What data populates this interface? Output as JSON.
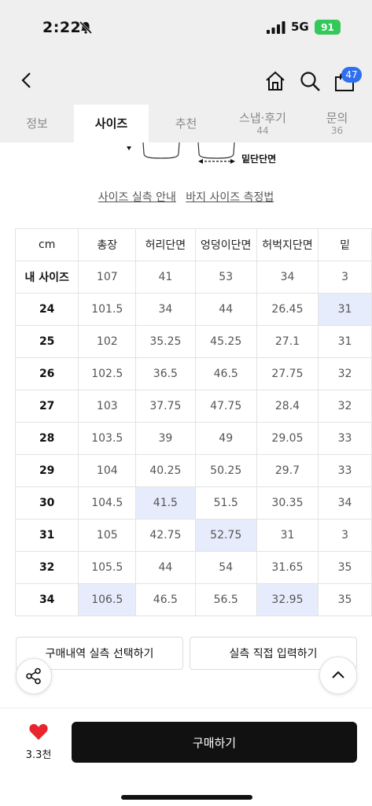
{
  "status": {
    "time": "2:22",
    "network": "5G",
    "battery": "91"
  },
  "nav": {
    "cart_count": "47"
  },
  "tabs": [
    {
      "label": "정보",
      "count": ""
    },
    {
      "label": "사이즈",
      "count": ""
    },
    {
      "label": "추천",
      "count": ""
    },
    {
      "label": "스냅·후기",
      "count": "44"
    },
    {
      "label": "문의",
      "count": "36"
    }
  ],
  "diagram": {
    "label": "밑단단면"
  },
  "links": {
    "guide": "사이즈 실측 안내",
    "measure": "바지 사이즈 측정법"
  },
  "size_table": {
    "headers": [
      "cm",
      "총장",
      "허리단면",
      "엉덩이단면",
      "허벅지단면",
      "밑"
    ],
    "rows": [
      {
        "label": "내 사이즈",
        "values": [
          "107",
          "41",
          "53",
          "34",
          "3"
        ],
        "highlight": []
      },
      {
        "label": "24",
        "values": [
          "101.5",
          "34",
          "44",
          "26.45",
          "31"
        ],
        "highlight": [
          4
        ]
      },
      {
        "label": "25",
        "values": [
          "102",
          "35.25",
          "45.25",
          "27.1",
          "31"
        ],
        "highlight": []
      },
      {
        "label": "26",
        "values": [
          "102.5",
          "36.5",
          "46.5",
          "27.75",
          "32"
        ],
        "highlight": []
      },
      {
        "label": "27",
        "values": [
          "103",
          "37.75",
          "47.75",
          "28.4",
          "32"
        ],
        "highlight": []
      },
      {
        "label": "28",
        "values": [
          "103.5",
          "39",
          "49",
          "29.05",
          "33"
        ],
        "highlight": []
      },
      {
        "label": "29",
        "values": [
          "104",
          "40.25",
          "50.25",
          "29.7",
          "33"
        ],
        "highlight": []
      },
      {
        "label": "30",
        "values": [
          "104.5",
          "41.5",
          "51.5",
          "30.35",
          "34"
        ],
        "highlight": [
          1
        ]
      },
      {
        "label": "31",
        "values": [
          "105",
          "42.75",
          "52.75",
          "31",
          "3"
        ],
        "highlight": [
          2
        ]
      },
      {
        "label": "32",
        "values": [
          "105.5",
          "44",
          "54",
          "31.65",
          "35"
        ],
        "highlight": []
      },
      {
        "label": "34",
        "values": [
          "106.5",
          "46.5",
          "56.5",
          "32.95",
          "35"
        ],
        "highlight": [
          0,
          3
        ]
      }
    ]
  },
  "actions": {
    "purchase_history": "구매내역 실측 선택하기",
    "direct_input": "실측 직접 입력하기"
  },
  "bottom": {
    "like_count": "3.3천",
    "buy_label": "구매하기"
  },
  "colors": {
    "highlight": "#e6ecfb",
    "badge": "#2f6ff0",
    "like": "#e8242f",
    "battery": "#34c759"
  }
}
